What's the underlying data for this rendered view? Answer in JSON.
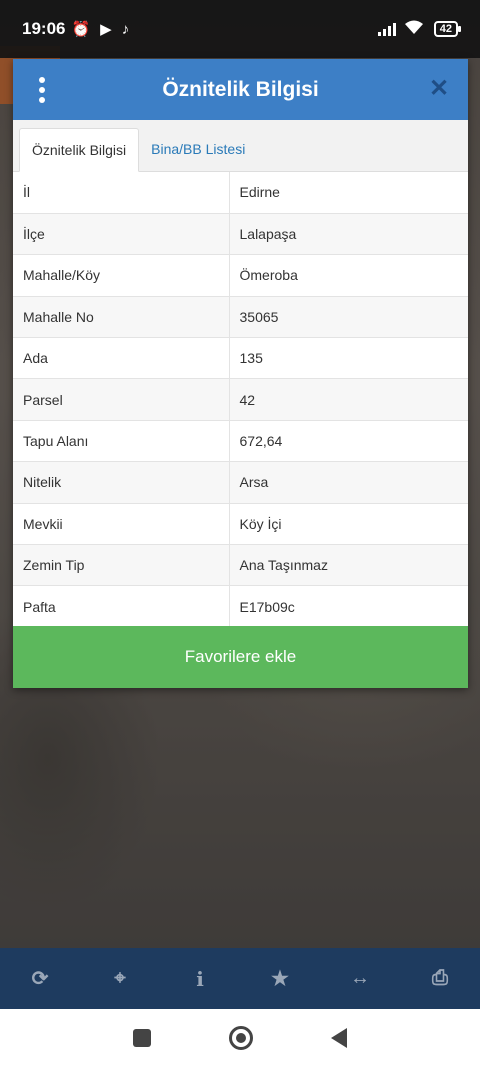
{
  "status_bar": {
    "time": "19:06",
    "battery": "42"
  },
  "dialog": {
    "title": "Öznitelik Bilgisi",
    "tabs": [
      {
        "label": "Öznitelik Bilgisi",
        "active": true
      },
      {
        "label": "Bina/BB Listesi",
        "active": false
      }
    ],
    "rows": [
      {
        "key": "İl",
        "value": "Edirne"
      },
      {
        "key": "İlçe",
        "value": "Lalapaşa"
      },
      {
        "key": "Mahalle/Köy",
        "value": "Ömeroba"
      },
      {
        "key": "Mahalle No",
        "value": "35065"
      },
      {
        "key": "Ada",
        "value": "135"
      },
      {
        "key": "Parsel",
        "value": "42"
      },
      {
        "key": "Tapu Alanı",
        "value": "672,64"
      },
      {
        "key": "Nitelik",
        "value": "Arsa"
      },
      {
        "key": "Mevkii",
        "value": "Köy İçi"
      },
      {
        "key": "Zemin Tip",
        "value": "Ana Taşınmaz"
      },
      {
        "key": "Pafta",
        "value": "E17b09c"
      }
    ],
    "favorite_button": "Favorilere ekle"
  },
  "toolbar": {
    "icons": [
      "refresh-icon",
      "locate-icon",
      "info-icon",
      "star-icon",
      "measure-icon",
      "print-icon"
    ]
  },
  "colors": {
    "header": "#3d7fc6",
    "favorite": "#5cb85c",
    "toolbar": "#1e3b5f"
  }
}
